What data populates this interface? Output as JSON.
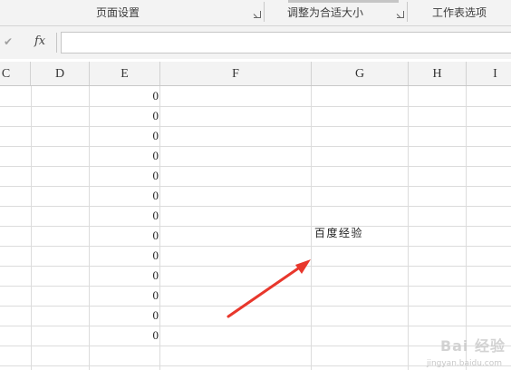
{
  "ribbon": {
    "page_setup": "页面设置",
    "scale_to_fit": "调整为合适大小",
    "sheet_options": "工作表选项"
  },
  "formula_bar": {
    "enter_icon": "check-icon",
    "fx_label": "fx",
    "value": ""
  },
  "columns": [
    "C",
    "D",
    "E",
    "F",
    "G",
    "H",
    "I"
  ],
  "cells": {
    "E": [
      "0",
      "0",
      "0",
      "0",
      "0",
      "0",
      "0",
      "0",
      "0",
      "0",
      "0",
      "0",
      "0"
    ],
    "G_note": "百度经验"
  },
  "watermark": {
    "main": "Bai 经验",
    "sub": "jingyan.baidu.com"
  },
  "colors": {
    "arrow": "#e8372c",
    "ribbon_bg": "#f3f3f3",
    "grid_line": "#dcdcdc"
  }
}
